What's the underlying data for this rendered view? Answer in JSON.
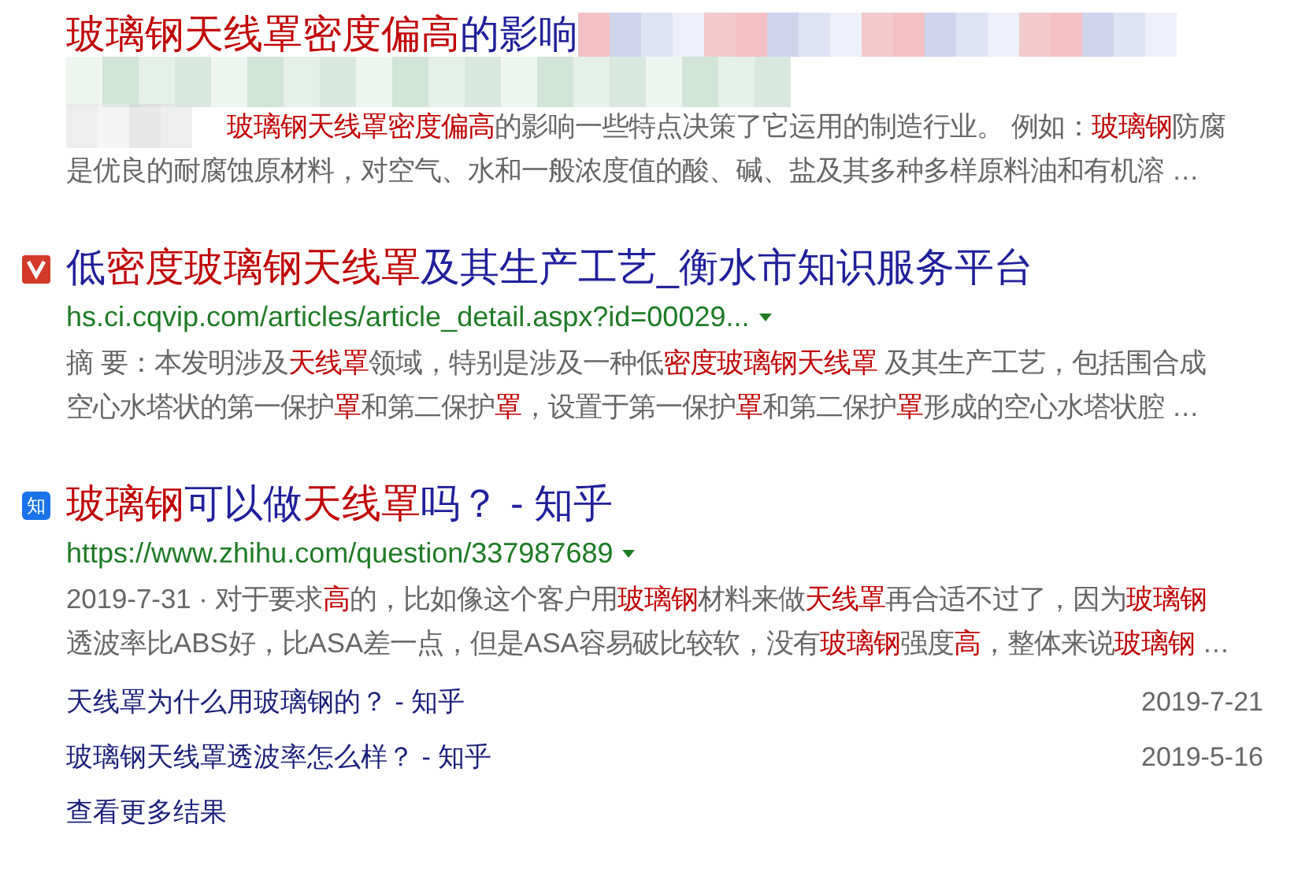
{
  "results": [
    {
      "kind": "blurred",
      "title": [
        {
          "text": "玻璃钢天线罩密度偏高",
          "hl": true
        },
        {
          "text": "的影响",
          "hl": false
        }
      ],
      "snippet": [
        [
          {
            "text": "玻璃钢天线罩密度偏高",
            "hl": true
          },
          {
            "text": "的影响一些特点决策了它运用的制造行业。 例如：",
            "hl": false
          },
          {
            "text": "玻璃钢",
            "hl": true
          },
          {
            "text": "防腐",
            "hl": false
          }
        ],
        [
          {
            "text": "是优良的耐腐蚀原材料，对空气、水和一般浓度值的酸、碱、盐及其多种多样原料油和有机溶 …",
            "hl": false
          }
        ]
      ]
    },
    {
      "kind": "logo",
      "title": [
        {
          "text": "低",
          "hl": false
        },
        {
          "text": "密度玻璃钢天线罩",
          "hl": true
        },
        {
          "text": "及其生产工艺_衡水市知识服务平台",
          "hl": false
        }
      ],
      "url": "hs.ci.cqvip.com/articles/article_detail.aspx?id=00029...",
      "snippet": [
        [
          {
            "text": "摘 要：本发明涉及",
            "hl": false
          },
          {
            "text": "天线罩",
            "hl": true
          },
          {
            "text": "领域，特别是涉及一种低",
            "hl": false
          },
          {
            "text": "密度玻璃钢天线罩",
            "hl": true
          },
          {
            "text": " 及其生产工艺，包括围合成",
            "hl": false
          }
        ],
        [
          {
            "text": "空心水塔状的第一保护",
            "hl": false
          },
          {
            "text": "罩",
            "hl": true
          },
          {
            "text": "和第二保护",
            "hl": false
          },
          {
            "text": "罩",
            "hl": true
          },
          {
            "text": "，设置于第一保护",
            "hl": false
          },
          {
            "text": "罩",
            "hl": true
          },
          {
            "text": "和第二保护",
            "hl": false
          },
          {
            "text": "罩",
            "hl": true
          },
          {
            "text": "形成的空心水塔状腔 …",
            "hl": false
          }
        ]
      ]
    },
    {
      "kind": "badge",
      "iconText": "知",
      "title": [
        {
          "text": "玻璃钢",
          "hl": true
        },
        {
          "text": "可以做",
          "hl": false
        },
        {
          "text": "天线罩",
          "hl": true
        },
        {
          "text": "吗？  - 知乎",
          "hl": false
        }
      ],
      "url": "https://www.zhihu.com/question/337987689",
      "snippet": [
        [
          {
            "text": "2019-7-31 · 对于要求",
            "hl": false
          },
          {
            "text": "高",
            "hl": true
          },
          {
            "text": "的，比如像这个客户用",
            "hl": false
          },
          {
            "text": "玻璃钢",
            "hl": true
          },
          {
            "text": "材料来做",
            "hl": false
          },
          {
            "text": "天线罩",
            "hl": true
          },
          {
            "text": "再合适不过了，因为",
            "hl": false
          },
          {
            "text": "玻璃钢",
            "hl": true
          }
        ],
        [
          {
            "text": "透波率比ABS好，比ASA差一点，但是ASA容易破比较软，没有",
            "hl": false
          },
          {
            "text": "玻璃钢",
            "hl": true
          },
          {
            "text": "强度",
            "hl": false
          },
          {
            "text": "高",
            "hl": true
          },
          {
            "text": "，整体来说",
            "hl": false
          },
          {
            "text": "玻璃钢",
            "hl": true
          },
          {
            "text": " …",
            "hl": false
          }
        ]
      ],
      "sublinks": [
        {
          "title": "天线罩为什么用玻璃钢的？ - 知乎",
          "date": "2019-7-21"
        },
        {
          "title": "玻璃钢天线罩透波率怎么样？ - 知乎",
          "date": "2019-5-16"
        }
      ],
      "more": "查看更多结果"
    }
  ]
}
